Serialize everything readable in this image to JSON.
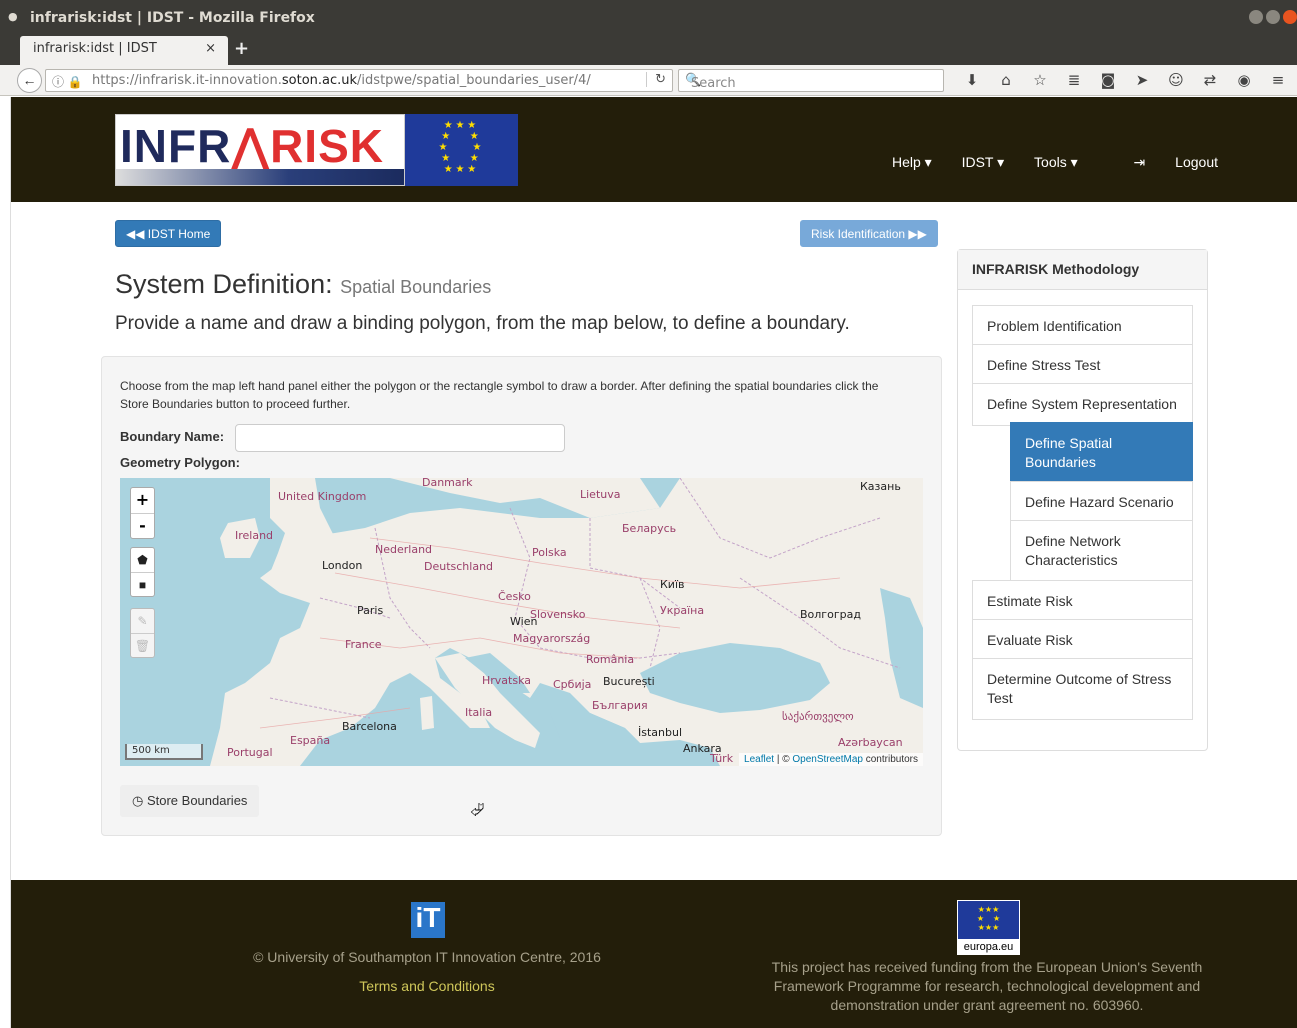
{
  "window": {
    "title": "infrarisk:idst | IDST - Mozilla Firefox",
    "tab_label": "infrarisk:idst | IDST",
    "tab_close": "×",
    "new_tab": "+"
  },
  "navbar": {
    "url_prefix": "https://infrarisk.it-innovation.",
    "url_domain": "soton.ac.uk",
    "url_path": "/idstpwe/spatial_boundaries_user/4/",
    "search_placeholder": "Search",
    "icons": [
      "download-icon",
      "home-icon",
      "bookmark-star-icon",
      "reading-list-icon",
      "pocket-icon",
      "send-icon",
      "chat-icon",
      "translate-icon",
      "account-icon",
      "menu-icon"
    ]
  },
  "header": {
    "logo_text_a": "INFR",
    "logo_text_b": "RISK",
    "nav": [
      "Help ▾",
      "IDST ▾",
      "Tools ▾",
      "Logout"
    ]
  },
  "buttons": {
    "home": "◀◀ IDST Home",
    "risk": "Risk Identification ▶▶",
    "store": "Store Boundaries"
  },
  "main": {
    "title": "System Definition:",
    "title_small": "Spatial Boundaries",
    "subtitle": "Provide a name and draw a binding polygon, from the map below, to define a boundary.",
    "instructions": "Choose from the map left hand panel either the polygon or the rectangle symbol to draw a border. After defining the spatial boundaries click the Store Boundaries button to proceed further.",
    "boundary_label": "Boundary Name:",
    "boundary_value": "",
    "geometry_label": "Geometry Polygon:"
  },
  "map": {
    "scale": "500 km",
    "attribution_leaflet": "Leaflet",
    "attribution_sep": " | © ",
    "attribution_osm": "OpenStreetMap",
    "attribution_tail": " contributors",
    "labels": {
      "danmark": "Danmark",
      "uk": "United Kingdom",
      "ireland": "Ireland",
      "london": "London",
      "nederland": "Nederland",
      "deutschland": "Deutschland",
      "polska": "Polska",
      "lietuva": "Lietuva",
      "belarus": "Беларусь",
      "kazan": "Казань",
      "paris": "Paris",
      "france": "France",
      "cesko": "Česko",
      "slovensko": "Slovensko",
      "wien": "Wien",
      "magyar": "Magyarország",
      "ukraina": "Україна",
      "kyiv": "Київ",
      "volgograd": "Волгоград",
      "romania": "România",
      "bucuresti": "București",
      "srbija": "Србија",
      "hrvatska": "Hrvatska",
      "bulgaria": "България",
      "italia": "Italia",
      "istanbul": "İstanbul",
      "ankara": "Ankara",
      "turk": "Türk",
      "barcelona": "Barcelona",
      "espana": "España",
      "portugal": "Portugal",
      "georgia": "საქართველო",
      "azerbaycan": "Azərbaycan"
    }
  },
  "sidebar": {
    "heading": "INFRARISK Methodology",
    "items": [
      "Problem Identification",
      "Define Stress Test",
      "Define System Representation",
      "Define Spatial Boundaries",
      "Define Hazard Scenario",
      "Define Network Characteristics",
      "Estimate Risk",
      "Evaluate Risk",
      "Determine Outcome of Stress Test"
    ]
  },
  "footer": {
    "it_logo": "iT",
    "copyright": "© University of Southampton IT Innovation Centre, 2016",
    "terms": "Terms and Conditions",
    "eu_url": "europa.eu",
    "eu_text": "This project has received funding from the European Union's Seventh Framework Programme for research, technological development and demonstration under grant agreement no. 603960."
  }
}
